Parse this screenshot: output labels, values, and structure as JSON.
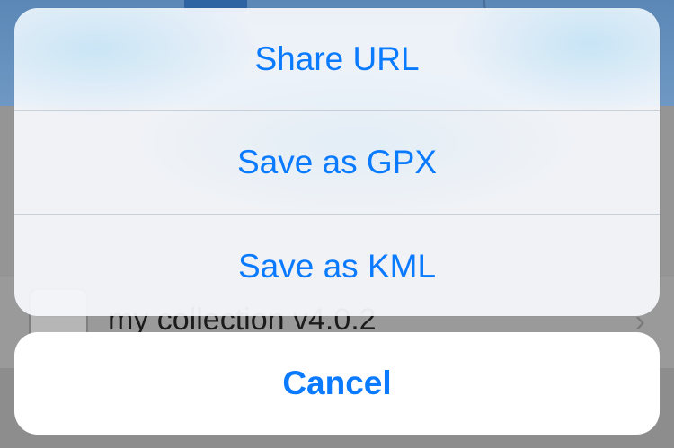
{
  "background": {
    "row_title": "my collection v4.0.2",
    "row_chevron": "›"
  },
  "action_sheet": {
    "items": [
      {
        "label": "Share URL"
      },
      {
        "label": "Save as GPX"
      },
      {
        "label": "Save as KML"
      }
    ],
    "cancel_label": "Cancel"
  },
  "colors": {
    "accent": "#0a7aff",
    "sheet_background": "#f5f8fc",
    "cancel_background": "#ffffff"
  }
}
